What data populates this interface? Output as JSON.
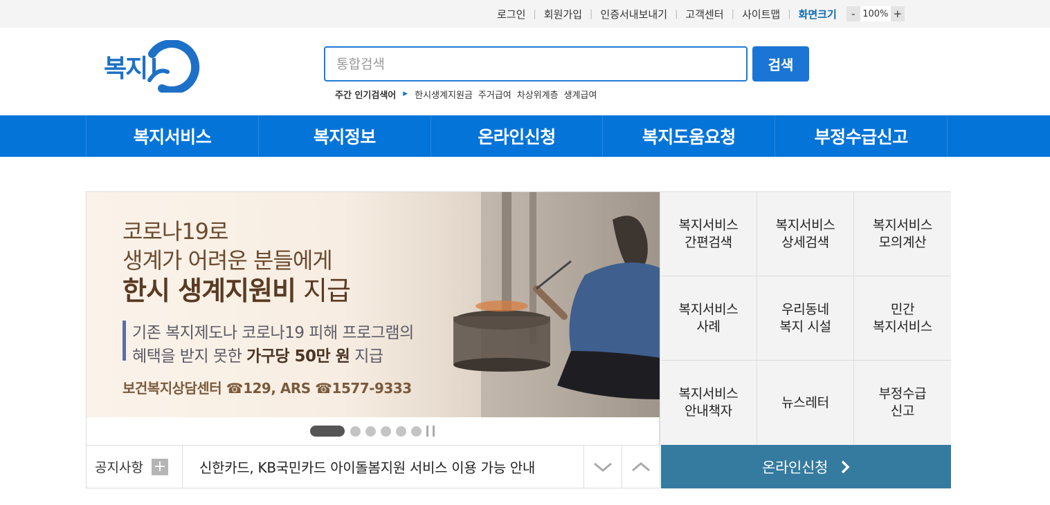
{
  "utility_bar": {
    "links": [
      "로그인",
      "회원가입",
      "인증서내보내기",
      "고객센터",
      "사이트맵"
    ],
    "screen_size_label": "화면크기",
    "zoom_minus": "-",
    "zoom_value": "100%",
    "zoom_plus": "+"
  },
  "header": {
    "logo_text": "복지",
    "search": {
      "placeholder": "통합검색",
      "button_label": "검색"
    },
    "popular": {
      "label": "주간 인기검색어",
      "keywords": [
        "한시생계지원금",
        "주거급여",
        "차상위계층",
        "생계급여"
      ]
    }
  },
  "gnb": {
    "items": [
      "복지서비스",
      "복지정보",
      "온라인신청",
      "복지도움요청",
      "부정수급신고"
    ]
  },
  "banner": {
    "line1": "코로나19로",
    "line2": "생계가 어려운 분들에게",
    "line3_bold": "한시 생계지원비",
    "line3_rest": " 지급",
    "desc1": "기존 복지제도나 코로나19 피해 프로그램의",
    "desc2_plain": "혜택을 받지 못한 ",
    "desc2_bold": "가구당 50만 원",
    "desc2_rest": " 지급",
    "contact": "보건복지상담센터 ☎129, ARS ☎1577-9333",
    "slide_count": 6,
    "active_slide": 1
  },
  "notice": {
    "title": "공지사항",
    "plus": "+",
    "text": "신한카드, KB국민카드 아이돌봄지원 서비스 이용 가능 안내"
  },
  "quick_menu": {
    "items": [
      "복지서비스\n간편검색",
      "복지서비스\n상세검색",
      "복지서비스\n모의계산",
      "복지서비스\n사례",
      "우리동네\n복지 시설",
      "민간\n복지서비스",
      "복지서비스\n안내책자",
      "뉴스레터",
      "부정수급\n신고"
    ]
  },
  "online_apply": {
    "label": "온라인신청"
  },
  "colors": {
    "brand_blue": "#0574d9",
    "search_button": "#1b75d4",
    "online_button": "#357a9f",
    "screen_size_text": "#0c6ab2"
  }
}
